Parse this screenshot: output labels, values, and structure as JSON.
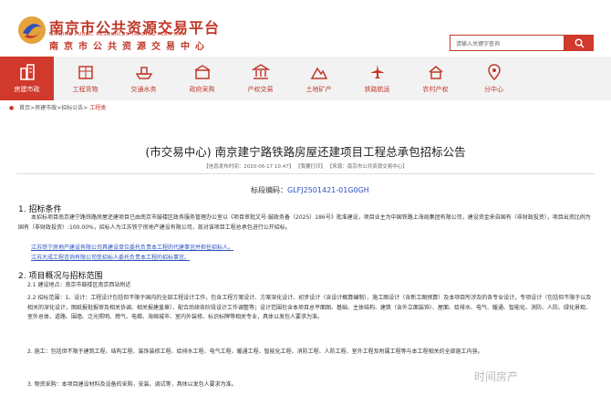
{
  "header": {
    "site_title": "南京市公共资源交易平台",
    "site_title_en": "NANJING PUBLIC RESOURCES TRADING PLATFORM",
    "site_title_repeat": "南京市公共资源交易中心",
    "search_placeholder": "请输入关键字查询",
    "brand_color": "#c0392b"
  },
  "nav": {
    "items": [
      {
        "label": "房建市政",
        "icon": "building-icon",
        "active": true
      },
      {
        "label": "工程货物",
        "icon": "goods-icon"
      },
      {
        "label": "交通水务",
        "icon": "ship-icon"
      },
      {
        "label": "政府采购",
        "icon": "government-icon"
      },
      {
        "label": "产权交易",
        "icon": "bank-icon"
      },
      {
        "label": "土地矿产",
        "icon": "land-icon"
      },
      {
        "label": "铁路航运",
        "icon": "plane-icon"
      },
      {
        "label": "农村产权",
        "icon": "farm-icon"
      },
      {
        "label": "分中心",
        "icon": "branch-icon"
      }
    ]
  },
  "breadcrumb": {
    "path": "首页>房建市政>招标公告>",
    "current": "工程类"
  },
  "article": {
    "title": "(市交易中心) 南京建宁路铁路房屋还建项目工程总承包招标公告",
    "meta": "【信息发布时间：2020-06-17 10:47】 【我要打印】 【来源：南京市公共资源交易中心】",
    "code_label": "标段编码：",
    "code_value": "GLFJ2501421-01G0GH",
    "s1_heading": "1. 招标条件",
    "s1_p1": "本招标项目南京建宁路铁路房屋还建项目已由南京市鼓楼区政务服务管理办公室以《项目审批文号:鼓政务备（2025）186号》批准建设，项目业主为中国铁路上海局集团有限公司，建设资金来自国有（非财政投资），项目出资比例为国有（非财政投资）:100.00%，招标人为江苏铁宁房地产建设有限公司，现对该项目工程总承包进行公开招标。",
    "s1_p2": "江苏铁宁房地产建设有限公司具建设单位委托负责本工程的代建事宜并担任招标人。",
    "s1_p3": "江苏大成工程咨询有限公司受招标人委托负责本工程的招标事宜。",
    "s2_heading": "2. 项目概况与招标范围",
    "s2_1": "2.1 建设地点：南京市鼓楼区南京西站附近",
    "s2_2": "2.2 招标范围：1、设计：工程设计包括但不限于国内的全部工程设计工作，包含工程方案设计、方案深化设计、初步设计（含设计概算编制）、施工图设计（含新工图预算）及本项目所涉及的各专业设计，专项设计（包括但不限于以及相关的深化设计，图纸报批报审及相关协调、相关报建盖章）、配合后续各阶段设计工作调整等；设计范围包含本项目总平面图、基础、主体结构、建筑（含外立面装饰）、屋面、给排水、电气、暖通、智能化、消防、人防、绿化景观、室外总体、道路、围墙、泛光照明、燃气、电梯、海绵城市、室内外装修、标识标牌等相关专业，具体以发包人要求为准。",
    "s2_3": "2. 施工：包括但不限于建筑工程、结构工程、装饰装修工程、给排水工程、电气工程、暖通工程、智能化工程、消防工程、人防工程、室外工程及附属工程等与本工程相关的全部施工内容。",
    "s2_4": "3. 物资采购：本项目建设材料及设备的采购，安装、调试等，具体以发包人要求为准。"
  },
  "watermark": "时间房产"
}
